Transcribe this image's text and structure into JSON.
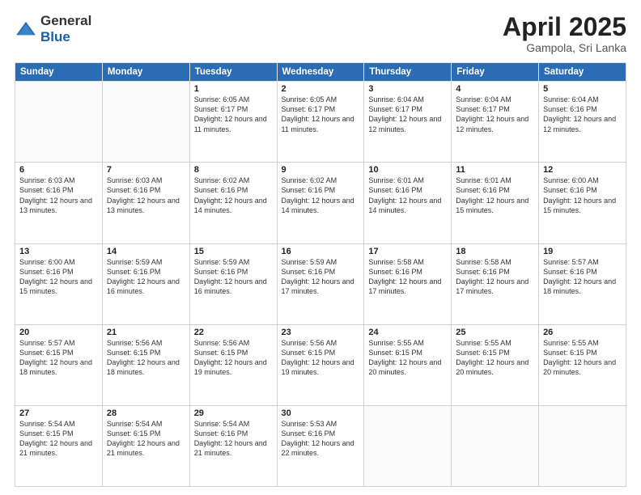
{
  "logo": {
    "general": "General",
    "blue": "Blue"
  },
  "title": "April 2025",
  "subtitle": "Gampola, Sri Lanka",
  "days": [
    "Sunday",
    "Monday",
    "Tuesday",
    "Wednesday",
    "Thursday",
    "Friday",
    "Saturday"
  ],
  "weeks": [
    [
      {
        "day": "",
        "info": ""
      },
      {
        "day": "",
        "info": ""
      },
      {
        "day": "1",
        "info": "Sunrise: 6:05 AM\nSunset: 6:17 PM\nDaylight: 12 hours and 11 minutes."
      },
      {
        "day": "2",
        "info": "Sunrise: 6:05 AM\nSunset: 6:17 PM\nDaylight: 12 hours and 11 minutes."
      },
      {
        "day": "3",
        "info": "Sunrise: 6:04 AM\nSunset: 6:17 PM\nDaylight: 12 hours and 12 minutes."
      },
      {
        "day": "4",
        "info": "Sunrise: 6:04 AM\nSunset: 6:17 PM\nDaylight: 12 hours and 12 minutes."
      },
      {
        "day": "5",
        "info": "Sunrise: 6:04 AM\nSunset: 6:16 PM\nDaylight: 12 hours and 12 minutes."
      }
    ],
    [
      {
        "day": "6",
        "info": "Sunrise: 6:03 AM\nSunset: 6:16 PM\nDaylight: 12 hours and 13 minutes."
      },
      {
        "day": "7",
        "info": "Sunrise: 6:03 AM\nSunset: 6:16 PM\nDaylight: 12 hours and 13 minutes."
      },
      {
        "day": "8",
        "info": "Sunrise: 6:02 AM\nSunset: 6:16 PM\nDaylight: 12 hours and 14 minutes."
      },
      {
        "day": "9",
        "info": "Sunrise: 6:02 AM\nSunset: 6:16 PM\nDaylight: 12 hours and 14 minutes."
      },
      {
        "day": "10",
        "info": "Sunrise: 6:01 AM\nSunset: 6:16 PM\nDaylight: 12 hours and 14 minutes."
      },
      {
        "day": "11",
        "info": "Sunrise: 6:01 AM\nSunset: 6:16 PM\nDaylight: 12 hours and 15 minutes."
      },
      {
        "day": "12",
        "info": "Sunrise: 6:00 AM\nSunset: 6:16 PM\nDaylight: 12 hours and 15 minutes."
      }
    ],
    [
      {
        "day": "13",
        "info": "Sunrise: 6:00 AM\nSunset: 6:16 PM\nDaylight: 12 hours and 15 minutes."
      },
      {
        "day": "14",
        "info": "Sunrise: 5:59 AM\nSunset: 6:16 PM\nDaylight: 12 hours and 16 minutes."
      },
      {
        "day": "15",
        "info": "Sunrise: 5:59 AM\nSunset: 6:16 PM\nDaylight: 12 hours and 16 minutes."
      },
      {
        "day": "16",
        "info": "Sunrise: 5:59 AM\nSunset: 6:16 PM\nDaylight: 12 hours and 17 minutes."
      },
      {
        "day": "17",
        "info": "Sunrise: 5:58 AM\nSunset: 6:16 PM\nDaylight: 12 hours and 17 minutes."
      },
      {
        "day": "18",
        "info": "Sunrise: 5:58 AM\nSunset: 6:16 PM\nDaylight: 12 hours and 17 minutes."
      },
      {
        "day": "19",
        "info": "Sunrise: 5:57 AM\nSunset: 6:16 PM\nDaylight: 12 hours and 18 minutes."
      }
    ],
    [
      {
        "day": "20",
        "info": "Sunrise: 5:57 AM\nSunset: 6:15 PM\nDaylight: 12 hours and 18 minutes."
      },
      {
        "day": "21",
        "info": "Sunrise: 5:56 AM\nSunset: 6:15 PM\nDaylight: 12 hours and 18 minutes."
      },
      {
        "day": "22",
        "info": "Sunrise: 5:56 AM\nSunset: 6:15 PM\nDaylight: 12 hours and 19 minutes."
      },
      {
        "day": "23",
        "info": "Sunrise: 5:56 AM\nSunset: 6:15 PM\nDaylight: 12 hours and 19 minutes."
      },
      {
        "day": "24",
        "info": "Sunrise: 5:55 AM\nSunset: 6:15 PM\nDaylight: 12 hours and 20 minutes."
      },
      {
        "day": "25",
        "info": "Sunrise: 5:55 AM\nSunset: 6:15 PM\nDaylight: 12 hours and 20 minutes."
      },
      {
        "day": "26",
        "info": "Sunrise: 5:55 AM\nSunset: 6:15 PM\nDaylight: 12 hours and 20 minutes."
      }
    ],
    [
      {
        "day": "27",
        "info": "Sunrise: 5:54 AM\nSunset: 6:15 PM\nDaylight: 12 hours and 21 minutes."
      },
      {
        "day": "28",
        "info": "Sunrise: 5:54 AM\nSunset: 6:15 PM\nDaylight: 12 hours and 21 minutes."
      },
      {
        "day": "29",
        "info": "Sunrise: 5:54 AM\nSunset: 6:16 PM\nDaylight: 12 hours and 21 minutes."
      },
      {
        "day": "30",
        "info": "Sunrise: 5:53 AM\nSunset: 6:16 PM\nDaylight: 12 hours and 22 minutes."
      },
      {
        "day": "",
        "info": ""
      },
      {
        "day": "",
        "info": ""
      },
      {
        "day": "",
        "info": ""
      }
    ]
  ]
}
